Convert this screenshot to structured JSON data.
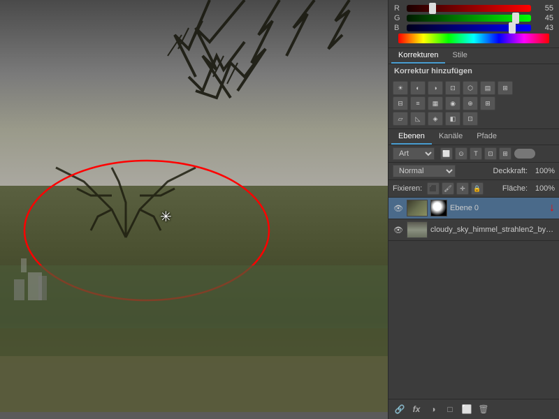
{
  "channels": {
    "r_label": "R",
    "g_label": "G",
    "b_label": "B",
    "r_value": "55",
    "g_value": "45",
    "b_value": "43",
    "r_percent": 22,
    "g_percent": 88,
    "b_percent": 85
  },
  "korrekturen_panel": {
    "tab1": "Korrekturen",
    "tab2": "Stile",
    "label": "Korrektur hinzufügen"
  },
  "layers_panel": {
    "tab1": "Ebenen",
    "tab2": "Kanäle",
    "tab3": "Pfade"
  },
  "filter": {
    "label": "Art"
  },
  "blend": {
    "mode": "Normal",
    "deckkraft_label": "Deckkraft:",
    "deckkraft_value": "100%",
    "flaeche_label": "Fläche:",
    "flaeche_value": "100%"
  },
  "fixieren": {
    "label": "Fixieren:"
  },
  "layers": [
    {
      "name": "Ebene 0",
      "visible": true,
      "active": true,
      "has_mask": true
    },
    {
      "name": "cloudy_sky_himmel_strahlen2_by_...",
      "visible": true,
      "active": false,
      "has_mask": false
    }
  ],
  "bottom_toolbar": {
    "link_icon": "🔗",
    "fx_label": "fx",
    "circle_icon": "○",
    "folder_icon": "□",
    "trash_icon": "🗑"
  },
  "icons": {
    "sun": "☀",
    "curve": "◌",
    "eye": "👁",
    "snowflake": "✳",
    "lock": "🔒"
  }
}
